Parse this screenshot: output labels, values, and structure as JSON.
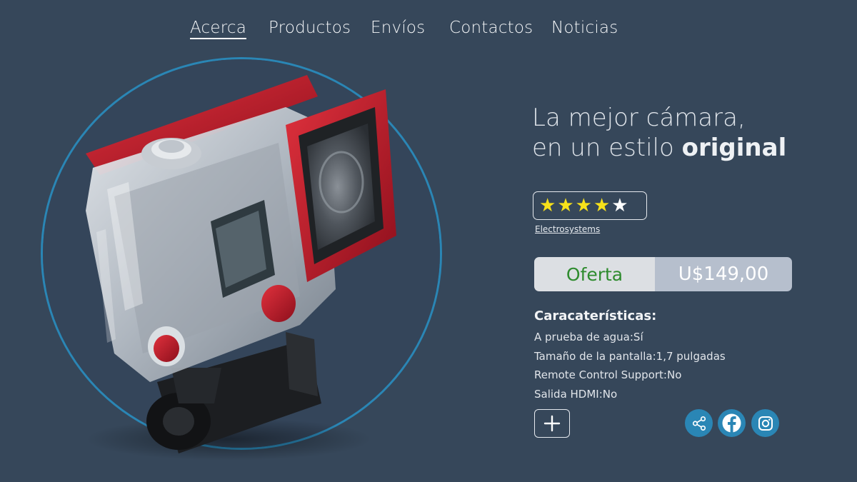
{
  "nav": {
    "links": [
      {
        "label": "Acerca",
        "active": true
      },
      {
        "label": "Productos",
        "active": false
      },
      {
        "label": "Envíos",
        "active": false
      },
      {
        "label": "Contactos",
        "active": false
      },
      {
        "label": "Noticias",
        "active": false
      }
    ]
  },
  "hero": {
    "image_icon": "action-camera-red-waterproof-case",
    "ring_color": "#2a86b5"
  },
  "product": {
    "headline_line1": "La mejor cámara,",
    "headline_line2_prefix": "en un estilo ",
    "headline_line2_bold": "original",
    "rating": {
      "value": 4,
      "max": 5
    },
    "brand": "Electrosystems",
    "offer_label": "Oferta",
    "price": "U$149,00",
    "features_title": "Caracaterísticas:",
    "features": [
      "A prueba de agua:Sí",
      "Tamaño de la pantalla:1,7 pulgadas",
      "Remote Control Support:No",
      "Salida HDMI:No"
    ]
  },
  "actions": {
    "add_icon": "plus-icon",
    "social": [
      "share-icon",
      "facebook-icon",
      "instagram-icon"
    ]
  },
  "colors": {
    "background": "#36475a",
    "accent": "#2a86b5",
    "star": "#f7e11a",
    "offer_text": "#2e8b2e"
  }
}
